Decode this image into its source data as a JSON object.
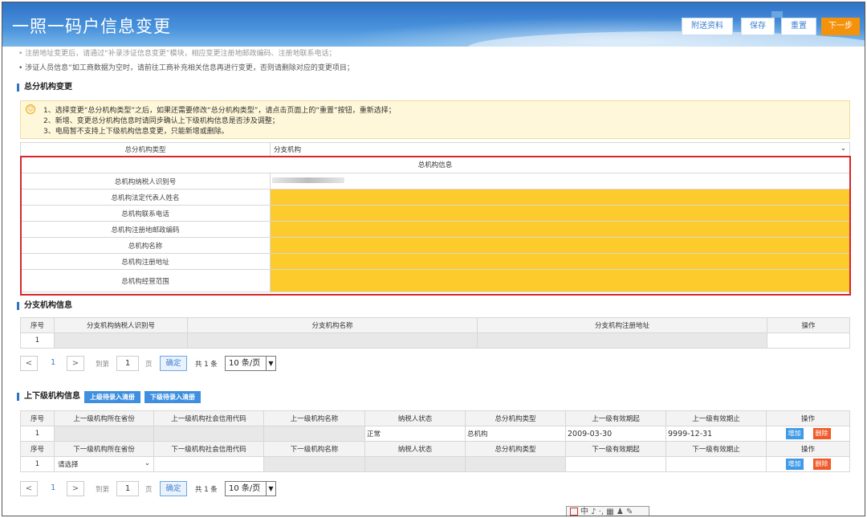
{
  "header": {
    "title": "一照一码户信息变更",
    "buttons": {
      "attach": "附送资料",
      "save": "保存",
      "reset": "重置",
      "next": "下一步"
    }
  },
  "notes": {
    "line1": "• 注册地址变更后，请通过“补录涉证信息变更”模块，相应变更注册地邮政编码、注册地联系电话；",
    "line2": "• 涉证人员信息”如工商数据为空时，请前往工商补充相关信息再进行变更，否则请删除对应的变更项目；"
  },
  "hq_section": {
    "title": "总分机构变更",
    "hints": [
      "1、选择变更“总分机构类型”之后，如果还需要修改“总分机构类型”，请点击页面上的“重置”按钮，重新选择；",
      "2、新增、变更总分机构信息时请同步确认上下级机构信息是否涉及调整；",
      "3、电局暂不支持上下级机构信息变更，只能新增或删除。"
    ],
    "type_label": "总分机构类型",
    "type_value": "分支机构",
    "info_header": "总机构信息",
    "fields": [
      "总机构纳税人识别号",
      "总机构法定代表人姓名",
      "总机构联系电话",
      "总机构注册地邮政编码",
      "总机构名称",
      "总机构注册地址",
      "总机构经营范围"
    ]
  },
  "branch_section": {
    "title": "分支机构信息",
    "columns": [
      "序号",
      "分支机构纳税人识别号",
      "分支机构名称",
      "分支机构注册地址",
      "操作"
    ],
    "rows": [
      {
        "index": "1"
      }
    ]
  },
  "pager1": {
    "prev": "<",
    "page": "1",
    "next": ">",
    "goto": "到第",
    "goto_value": "1",
    "page_unit": "页",
    "confirm": "确定",
    "total": "共 1 条",
    "size": "10 条/页"
  },
  "superior_section": {
    "title": "上下级机构信息",
    "btn_upper": "上级待录入清册",
    "btn_lower": "下级待录入清册",
    "upper_columns": [
      "序号",
      "上一级机构所在省份",
      "上一级机构社会信用代码",
      "上一级机构名称",
      "纳税人状态",
      "总分机构类型",
      "上一级有效期起",
      "上一级有效期止",
      "操作"
    ],
    "upper_row": {
      "index": "1",
      "status": "正常",
      "type": "总机构",
      "start": "2009-03-30",
      "end": "9999-12-31",
      "add": "增加",
      "del": "删除"
    },
    "lower_columns": [
      "序号",
      "下一级机构所在省份",
      "下一级机构社会信用代码",
      "下一级机构名称",
      "纳税人状态",
      "总分机构类型",
      "下一级有效期起",
      "下一级有效期止",
      "操作"
    ],
    "lower_row": {
      "index": "1",
      "province": "请选择",
      "add": "增加",
      "del": "删除"
    }
  },
  "pager2": {
    "prev": "<",
    "page": "1",
    "next": ">",
    "goto": "到第",
    "goto_value": "1",
    "page_unit": "页",
    "confirm": "确定",
    "total": "共 1 条",
    "size": "10 条/页"
  },
  "ime": {
    "text": "中 ♪ ·, ▦ ♟ ✎"
  }
}
